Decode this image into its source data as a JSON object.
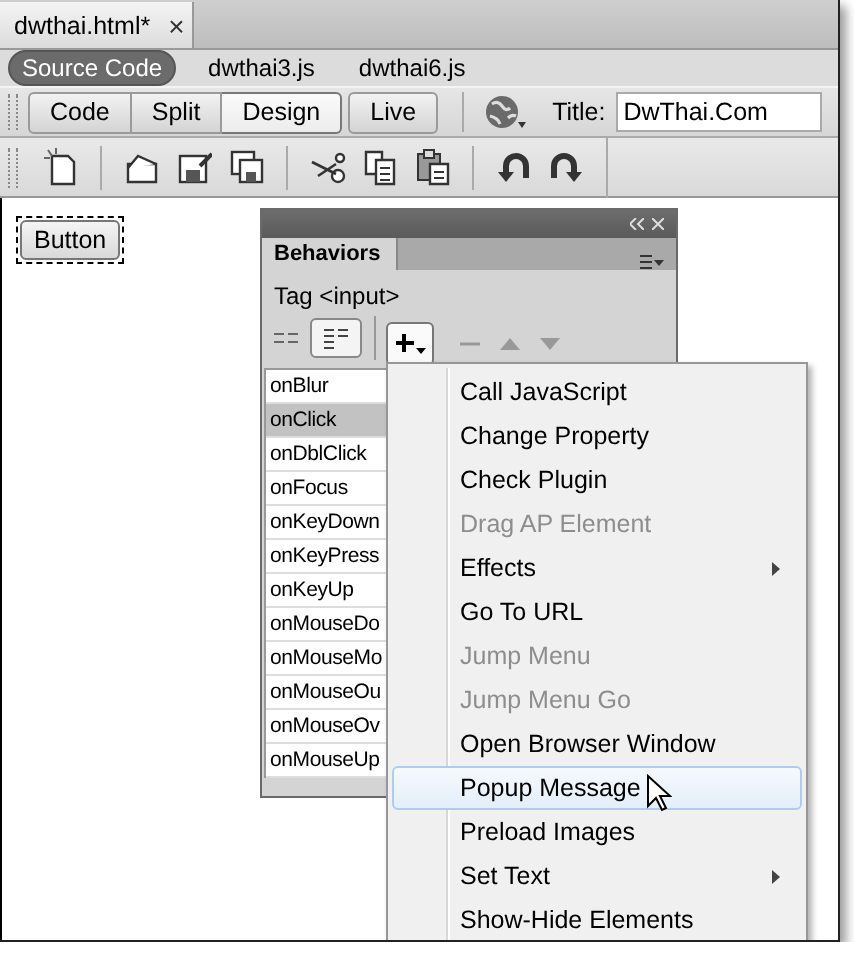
{
  "document_tab": {
    "title": "dwthai.html*",
    "close": "×"
  },
  "related_files": [
    {
      "label": "Source Code",
      "selected": true
    },
    {
      "label": "dwthai3.js",
      "selected": false
    },
    {
      "label": "dwthai6.js",
      "selected": false
    }
  ],
  "view_buttons": [
    {
      "label": "Code",
      "selected": false
    },
    {
      "label": "Split",
      "selected": false
    },
    {
      "label": "Design",
      "selected": true
    },
    {
      "label": "Live",
      "selected": false
    }
  ],
  "title_field": {
    "label": "Title:",
    "value": "DwThai.Com"
  },
  "design_view": {
    "button_label": "Button"
  },
  "behaviors_panel": {
    "tab": "Behaviors",
    "tag_label": "Tag <input>",
    "events": [
      {
        "label": "onBlur",
        "selected": false
      },
      {
        "label": "onClick",
        "selected": true
      },
      {
        "label": "onDblClick",
        "selected": false
      },
      {
        "label": "onFocus",
        "selected": false
      },
      {
        "label": "onKeyDown",
        "selected": false
      },
      {
        "label": "onKeyPress",
        "selected": false
      },
      {
        "label": "onKeyUp",
        "selected": false
      },
      {
        "label": "onMouseDo",
        "selected": false
      },
      {
        "label": "onMouseMo",
        "selected": false
      },
      {
        "label": "onMouseOu",
        "selected": false
      },
      {
        "label": "onMouseOv",
        "selected": false
      },
      {
        "label": "onMouseUp",
        "selected": false
      }
    ]
  },
  "add_menu": {
    "items": [
      {
        "label": "Call JavaScript",
        "disabled": false,
        "has_submenu": false,
        "selected": false
      },
      {
        "label": "Change Property",
        "disabled": false,
        "has_submenu": false,
        "selected": false
      },
      {
        "label": "Check Plugin",
        "disabled": false,
        "has_submenu": false,
        "selected": false
      },
      {
        "label": "Drag AP Element",
        "disabled": true,
        "has_submenu": false,
        "selected": false
      },
      {
        "label": "Effects",
        "disabled": false,
        "has_submenu": true,
        "selected": false
      },
      {
        "label": "Go To URL",
        "disabled": false,
        "has_submenu": false,
        "selected": false
      },
      {
        "label": "Jump Menu",
        "disabled": true,
        "has_submenu": false,
        "selected": false
      },
      {
        "label": "Jump Menu Go",
        "disabled": true,
        "has_submenu": false,
        "selected": false
      },
      {
        "label": "Open Browser Window",
        "disabled": false,
        "has_submenu": false,
        "selected": false
      },
      {
        "label": "Popup Message",
        "disabled": false,
        "has_submenu": false,
        "selected": true
      },
      {
        "label": "Preload Images",
        "disabled": false,
        "has_submenu": false,
        "selected": false
      },
      {
        "label": "Set Text",
        "disabled": false,
        "has_submenu": true,
        "selected": false
      },
      {
        "label": "Show-Hide Elements",
        "disabled": false,
        "has_submenu": false,
        "selected": false
      }
    ]
  }
}
